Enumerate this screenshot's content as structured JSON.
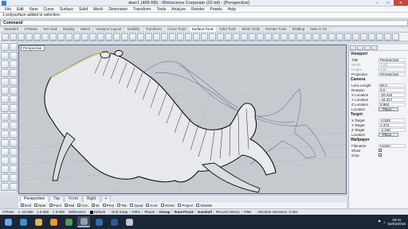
{
  "window": {
    "title": "deer1 (495 KB) - Rhinoceros Corporate (32-bit) - [Perspective]"
  },
  "menu": [
    "File",
    "Edit",
    "View",
    "Curve",
    "Surface",
    "Solid",
    "Mesh",
    "Dimension",
    "Transform",
    "Tools",
    "Analyze",
    "Render",
    "Panels",
    "Help"
  ],
  "command": {
    "history": "1 polysurface added to selection.",
    "prompt_label": "Command",
    "value": ""
  },
  "toolbar_tabs": [
    "Standard",
    "CPlanes",
    "Set View",
    "Display",
    "Select",
    "Viewport Layout",
    "Visibility",
    "Transform",
    "Curve Tools",
    "Surface Tools",
    "Solid Tools",
    "Mesh Tools",
    "Render Tools",
    "Drafting",
    "New in V5"
  ],
  "active_toolbar_tab": "Surface Tools",
  "viewport": {
    "label": "Perspective"
  },
  "viewport_tabs": [
    "Perspective",
    "Top",
    "Front",
    "Right",
    "+"
  ],
  "osnaps": [
    {
      "label": "End",
      "checked": true
    },
    {
      "label": "Near",
      "checked": true
    },
    {
      "label": "Point",
      "checked": true
    },
    {
      "label": "Mid",
      "checked": true
    },
    {
      "label": "Cen",
      "checked": true
    },
    {
      "label": "Int",
      "checked": true
    },
    {
      "label": "Perp",
      "checked": false
    },
    {
      "label": "Tan",
      "checked": false
    },
    {
      "label": "Quad",
      "checked": false
    },
    {
      "label": "Knot",
      "checked": true
    },
    {
      "label": "Vertex",
      "checked": false
    },
    {
      "label": "Project",
      "checked": false
    },
    {
      "label": "Disable",
      "checked": false
    }
  ],
  "status": {
    "cplane": "CPlane",
    "x": "x -18.390",
    "y": "y 6.250",
    "z": "z 0.000",
    "units": "Millimeters",
    "layer": "Default",
    "buttons": [
      {
        "label": "Grid Snap",
        "on": false
      },
      {
        "label": "Ortho",
        "on": false
      },
      {
        "label": "Planar",
        "on": false
      },
      {
        "label": "Osnap",
        "on": true
      },
      {
        "label": "SmartTrack",
        "on": true
      },
      {
        "label": "Gumball",
        "on": true
      },
      {
        "label": "Record History",
        "on": false
      },
      {
        "label": "Filter",
        "on": false
      }
    ],
    "tolerance": "Absolute tolerance: 0.001"
  },
  "properties": {
    "viewport_title": "Viewport",
    "viewport_rows": [
      {
        "k": "Title",
        "v": "Perspective",
        "dim": false
      },
      {
        "k": "Width",
        "v": "1160",
        "dim": true
      },
      {
        "k": "Height",
        "v": "438",
        "dim": true
      },
      {
        "k": "Projection",
        "v": "Perspective",
        "dim": false
      }
    ],
    "camera_title": "Camera",
    "camera_rows": [
      {
        "k": "Lens Length",
        "v": "50.0"
      },
      {
        "k": "Rotation",
        "v": "0.0"
      },
      {
        "k": "X Location",
        "v": "-20.423"
      },
      {
        "k": "Y Location",
        "v": "-44.317"
      },
      {
        "k": "Z Location",
        "v": "9.964"
      }
    ],
    "location_label": "Location",
    "place_label": "Place...",
    "target_title": "Target",
    "target_rows": [
      {
        "k": "X Target",
        "v": "-0.529"
      },
      {
        "k": "Y Target",
        "v": "1.372"
      },
      {
        "k": "Z Target",
        "v": "-2.346"
      }
    ],
    "target_location_label": "Location",
    "target_place_label": "Place...",
    "wallpaper_title": "Wallpaper",
    "wallpaper_rows": [
      {
        "k": "Filename",
        "v": "(none)"
      },
      {
        "k": "Show",
        "v": "",
        "checked": true
      },
      {
        "k": "Gray",
        "v": "",
        "checked": true
      }
    ]
  },
  "taskbar": {
    "apps": [
      "windows-start-icon",
      "ie-icon",
      "explorer-icon",
      "media-icon",
      "chrome-icon",
      "rhino-icon",
      "photoshop-icon",
      "word-icon",
      "app-icon"
    ],
    "time": "19:41",
    "date": "02/02/2015"
  },
  "colors": {
    "viewport_bg": "#c6cacf",
    "accent": "#3b7fd0",
    "taskbar": "#1b2736"
  }
}
